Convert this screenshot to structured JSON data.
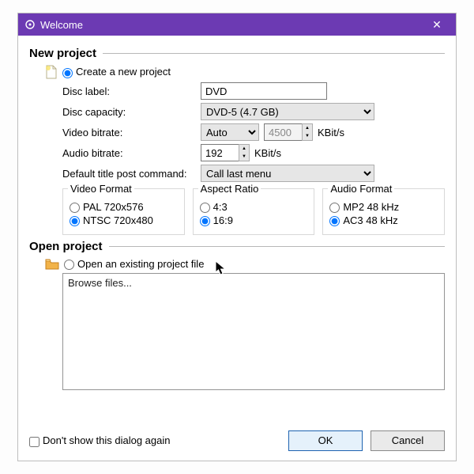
{
  "window": {
    "title": "Welcome",
    "close_glyph": "✕"
  },
  "sections": {
    "new_project": "New project",
    "open_project": "Open project"
  },
  "radios": {
    "create_new": "Create a new project",
    "open_existing": "Open an existing project file"
  },
  "labels": {
    "disc_label": "Disc label:",
    "disc_capacity": "Disc capacity:",
    "video_bitrate": "Video bitrate:",
    "audio_bitrate": "Audio bitrate:",
    "default_post": "Default title post command:",
    "video_format": "Video Format",
    "aspect_ratio": "Aspect Ratio",
    "audio_format": "Audio Format",
    "browse_files": "Browse files...",
    "dont_show": "Don't show this dialog again",
    "kbits": "KBit/s"
  },
  "values": {
    "disc_label": "DVD",
    "disc_capacity": "DVD-5 (4.7 GB)",
    "video_bitrate_mode": "Auto",
    "video_bitrate_value": "4500",
    "audio_bitrate": "192",
    "default_post": "Call last menu"
  },
  "options": {
    "video_format": {
      "pal": "PAL 720x576",
      "ntsc": "NTSC 720x480"
    },
    "aspect_ratio": {
      "r43": "4:3",
      "r169": "16:9"
    },
    "audio_format": {
      "mp2": "MP2 48 kHz",
      "ac3": "AC3 48 kHz"
    }
  },
  "buttons": {
    "ok": "OK",
    "cancel": "Cancel"
  }
}
